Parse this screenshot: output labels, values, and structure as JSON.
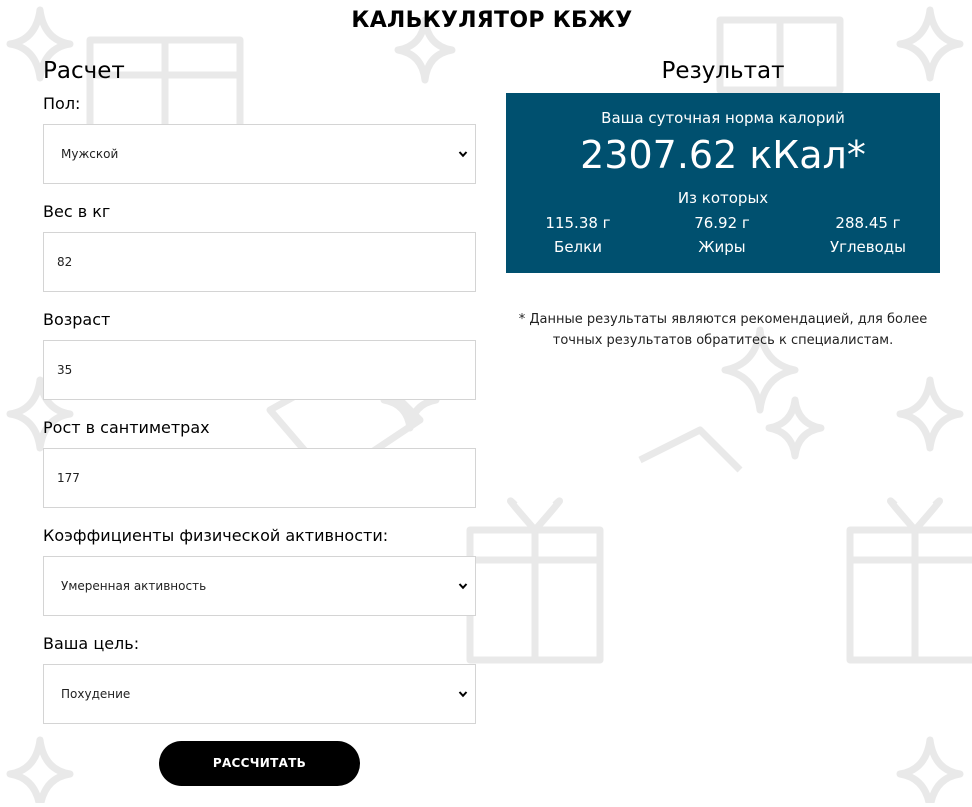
{
  "title": "КАЛЬКУЛЯТОР КБЖУ",
  "calc": {
    "heading": "Расчет",
    "fields": [
      {
        "label": "Пол:",
        "value": "Мужской",
        "type": "select"
      },
      {
        "label": "Вес в кг",
        "value": "82",
        "type": "input"
      },
      {
        "label": "Возраст",
        "value": "35",
        "type": "input"
      },
      {
        "label": "Рост в сантиметрах",
        "value": "177",
        "type": "input"
      },
      {
        "label": "Коэффициенты физической активности:",
        "value": "Умеренная активность",
        "type": "select"
      },
      {
        "label": "Ваша цель:",
        "value": "Похудение",
        "type": "select"
      }
    ],
    "button_label": "РАССЧИТАТЬ"
  },
  "result": {
    "heading": "Результат",
    "caption": "Ваша суточная норма калорий",
    "calories": "2307.62 кКал*",
    "sub_caption": "Из которых",
    "macros": [
      {
        "amount": "115.38 г",
        "name": "Белки"
      },
      {
        "amount": "76.92 г",
        "name": "Жиры"
      },
      {
        "amount": "288.45 г",
        "name": "Углеводы"
      }
    ],
    "disclaimer": "* Данные результаты являются рекомендацией, для более точных результатов обратитесь к специалистам."
  },
  "colors": {
    "panel": "#00506f",
    "button": "#000000",
    "pattern": "#e9e9e9"
  },
  "icons": [
    "sparkle-icon",
    "gift-icon",
    "chevron-down-icon"
  ]
}
